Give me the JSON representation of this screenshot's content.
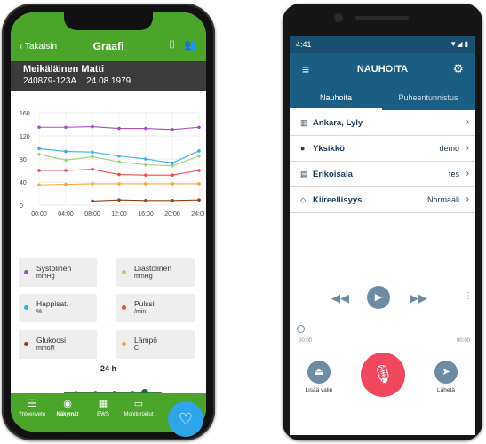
{
  "left_phone": {
    "header": {
      "back_label": "Takaisin",
      "title": "Graafi",
      "icons": [
        "qr-scan-icon",
        "people-icon"
      ]
    },
    "patient": {
      "name": "Meikäläinen Matti",
      "id": "240879-123A",
      "birthdate": "24.08.1979"
    },
    "chart_data": {
      "type": "line",
      "x": [
        "00:00",
        "04:00",
        "08:00",
        "12:00",
        "16:00",
        "20:00",
        "24:00"
      ],
      "y_ticks": [
        0,
        40,
        80,
        120,
        160
      ],
      "ylim": [
        0,
        160
      ],
      "grid": true,
      "series": [
        {
          "name": "Systolinen",
          "color": "#a050b8",
          "values": [
            135,
            135,
            136,
            133,
            133,
            131,
            135
          ]
        },
        {
          "name": "Diastolinen",
          "color": "#9fd07c",
          "values": [
            88,
            78,
            84,
            75,
            70,
            68,
            85
          ]
        },
        {
          "name": "Happisat.",
          "color": "#3ab0e0",
          "values": [
            98,
            93,
            92,
            85,
            80,
            73,
            94
          ]
        },
        {
          "name": "Pulssi",
          "color": "#e84a54",
          "values": [
            60,
            60,
            62,
            53,
            52,
            52,
            60
          ]
        },
        {
          "name": "Lämpö",
          "color": "#f2a93c",
          "values": [
            35,
            36,
            37,
            37,
            37,
            37,
            37
          ]
        },
        {
          "name": "Glukoosi",
          "color": "#8b4513",
          "x_start_index": 2,
          "values": [
            7,
            9,
            8,
            8,
            9
          ]
        }
      ]
    },
    "legend": [
      {
        "name": "Systolinen",
        "unit": "mmHg",
        "color": "#a050b8"
      },
      {
        "name": "Diastolinen",
        "unit": "mmHg",
        "color": "#9fd07c"
      },
      {
        "name": "Happisat.",
        "unit": "%",
        "color": "#3ab0e0"
      },
      {
        "name": "Pulssi",
        "unit": "/min",
        "color": "#e84a54"
      },
      {
        "name": "Glukoosi",
        "unit": "mmol/l",
        "color": "#8b4513"
      },
      {
        "name": "Lämpö",
        "unit": "C",
        "color": "#f2a93c"
      }
    ],
    "range_label": "24 h",
    "range_slider_position": 0.8,
    "tabbar": [
      {
        "label": "Yhteenveto",
        "icon": "list-icon",
        "active": false
      },
      {
        "label": "Näkymät",
        "icon": "eye-icon",
        "active": true
      },
      {
        "label": "EWS",
        "icon": "chart-icon",
        "active": false
      },
      {
        "label": "Monitoroidut",
        "icon": "monitor-icon",
        "active": false
      }
    ],
    "fab_icon": "add-patient-heart-icon",
    "colors": {
      "primary_green": "#4ba52b",
      "dark_header": "#3b3b3b",
      "fab_blue": "#2ea4e9"
    }
  },
  "right_phone": {
    "status": {
      "time": "4:41",
      "icons": "▼◢ ▮"
    },
    "appbar": {
      "title": "NAUHOITA",
      "menu_icon": "hamburger-icon",
      "settings_icon": "gear-icon"
    },
    "tabs": [
      {
        "label": "Nauhoita",
        "active": true
      },
      {
        "label": "Puheentunnistus",
        "active": false
      }
    ],
    "rows": [
      {
        "icon": "building-icon",
        "label": "Ankara, Lyly",
        "value": ""
      },
      {
        "icon": "person-icon",
        "label": "Yksikkö",
        "value": "demo"
      },
      {
        "icon": "document-icon",
        "label": "Erikoisala",
        "value": "tes"
      },
      {
        "icon": "pin-icon",
        "label": "Kiireellisyys",
        "value": "Normaali"
      }
    ],
    "player": {
      "start_time": "00:00",
      "end_time": "00:00"
    },
    "actions": {
      "left_label": "Lisää valin",
      "right_label": "Lähetä"
    },
    "colors": {
      "appbar": "#1b5e84",
      "status": "#1b4f70",
      "mic": "#f0465e",
      "control": "#6c8ca4"
    }
  }
}
